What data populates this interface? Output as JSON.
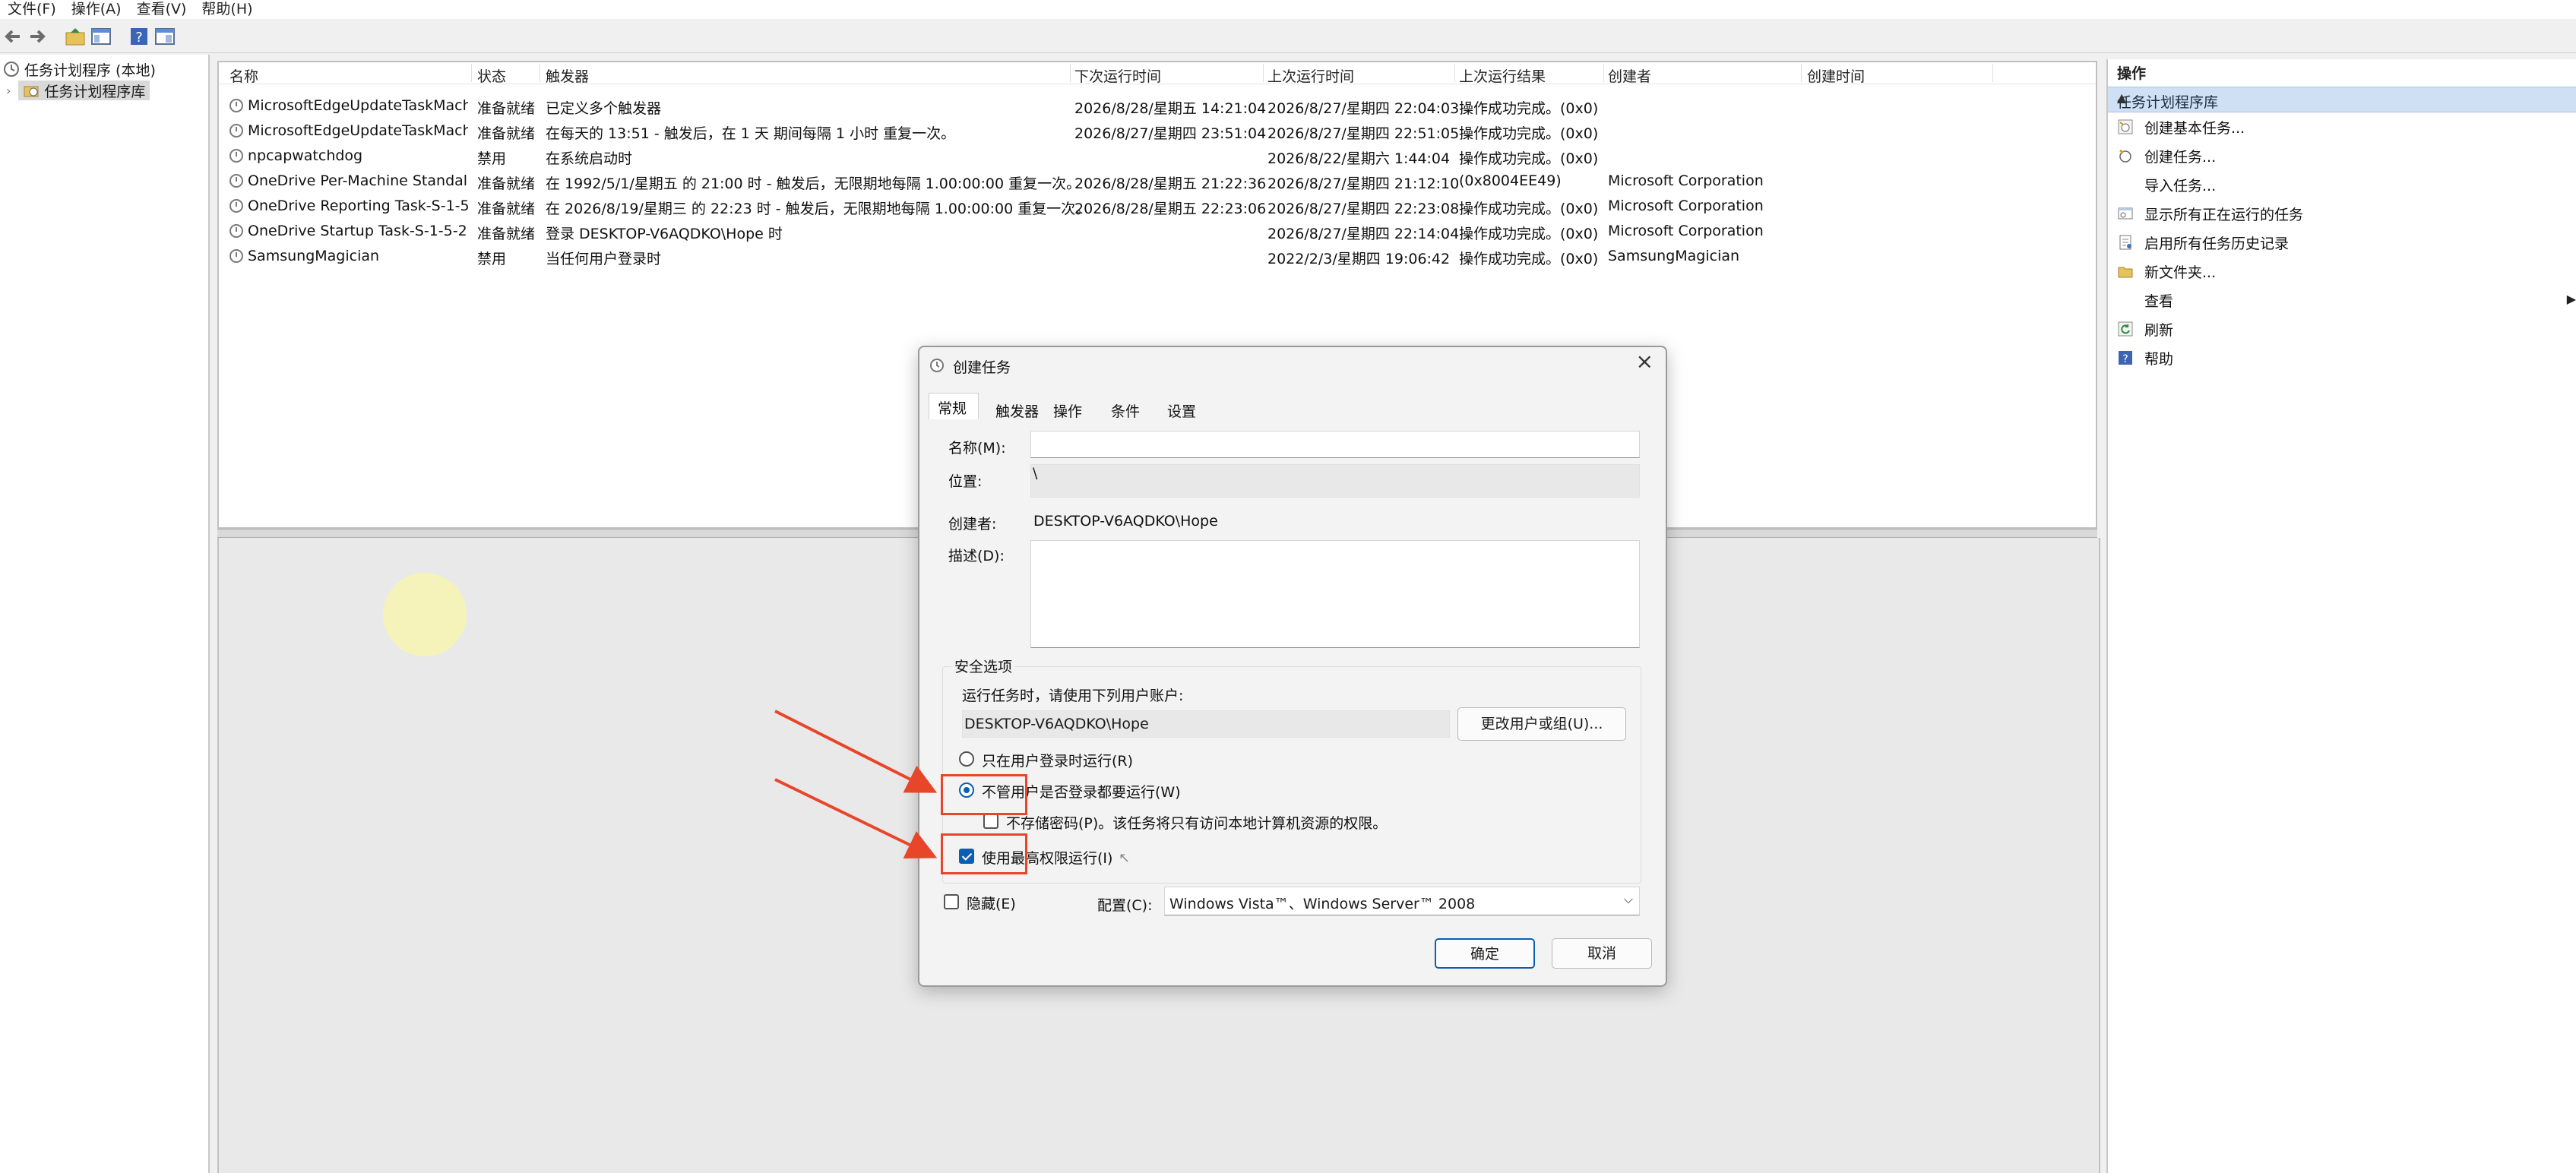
{
  "menu": [
    "文件(F)",
    "操作(A)",
    "查看(V)",
    "帮助(H)"
  ],
  "tree": {
    "root": "任务计划程序 (本地)",
    "library": "任务计划程序库"
  },
  "table": {
    "columns": [
      "名称",
      "状态",
      "触发器",
      "下次运行时间",
      "上次运行时间",
      "上次运行结果",
      "创建者",
      "创建时间"
    ],
    "rows": [
      {
        "name": "MicrosoftEdgeUpdateTaskMachi...",
        "status": "准备就绪",
        "trigger": "已定义多个触发器",
        "next": "2026/8/28/星期五 14:21:04",
        "last": "2026/8/27/星期四 22:04:03",
        "result": "操作成功完成。(0x0)",
        "author": ""
      },
      {
        "name": "MicrosoftEdgeUpdateTaskMachi...",
        "status": "准备就绪",
        "trigger": "在每天的 13:51 - 触发后，在 1 天 期间每隔 1 小时 重复一次。",
        "next": "2026/8/27/星期四 23:51:04",
        "last": "2026/8/27/星期四 22:51:05",
        "result": "操作成功完成。(0x0)",
        "author": ""
      },
      {
        "name": "npcapwatchdog",
        "status": "禁用",
        "trigger": "在系统启动时",
        "next": "",
        "last": "2026/8/22/星期六 1:44:04",
        "result": "操作成功完成。(0x0)",
        "author": ""
      },
      {
        "name": "OneDrive Per-Machine Standalo...",
        "status": "准备就绪",
        "trigger": "在 1992/5/1/星期五 的 21:00 时 - 触发后，无限期地每隔 1.00:00:00 重复一次。",
        "next": "2026/8/28/星期五 21:22:36",
        "last": "2026/8/27/星期四 21:12:10",
        "result": "(0x8004EE49)",
        "author": "Microsoft Corporation"
      },
      {
        "name": "OneDrive Reporting Task-S-1-5...",
        "status": "准备就绪",
        "trigger": "在 2026/8/19/星期三 的 22:23 时 - 触发后，无限期地每隔 1.00:00:00 重复一次。",
        "next": "2026/8/28/星期五 22:23:06",
        "last": "2026/8/27/星期四 22:23:08",
        "result": "操作成功完成。(0x0)",
        "author": "Microsoft Corporation"
      },
      {
        "name": "OneDrive Startup Task-S-1-5-2...",
        "status": "准备就绪",
        "trigger": "登录 DESKTOP-V6AQDKO\\Hope 时",
        "next": "",
        "last": "2026/8/27/星期四 22:14:04",
        "result": "操作成功完成。(0x0)",
        "author": "Microsoft Corporation"
      },
      {
        "name": "SamsungMagician",
        "status": "禁用",
        "trigger": "当任何用户登录时",
        "next": "",
        "last": "2022/2/3/星期四 19:06:42",
        "result": "操作成功完成。(0x0)",
        "author": "SamsungMagician"
      }
    ]
  },
  "actions": {
    "title": "操作",
    "section": "任务计划程序库",
    "items": [
      {
        "label": "创建基本任务...",
        "icon": "wizard-icon"
      },
      {
        "label": "创建任务...",
        "icon": "new-task-icon"
      },
      {
        "label": "导入任务...",
        "icon": ""
      },
      {
        "label": "显示所有正在运行的任务",
        "icon": "running-tasks-icon"
      },
      {
        "label": "启用所有任务历史记录",
        "icon": "history-icon"
      },
      {
        "label": "新文件夹...",
        "icon": "folder-icon"
      },
      {
        "label": "查看",
        "icon": ""
      },
      {
        "label": "刷新",
        "icon": "refresh-icon"
      },
      {
        "label": "帮助",
        "icon": "help-icon"
      }
    ]
  },
  "dialog": {
    "title": "创建任务",
    "tabs": [
      "常规",
      "触发器",
      "操作",
      "条件",
      "设置"
    ],
    "name_label": "名称(M):",
    "name_value": "",
    "location_label": "位置:",
    "location_value": "\\",
    "author_label": "创建者:",
    "author_value": "DESKTOP-V6AQDKO\\Hope",
    "desc_label": "描述(D):",
    "desc_value": "",
    "security_group": "安全选项",
    "run_as_label": "运行任务时，请使用下列用户账户:",
    "run_as_value": "DESKTOP-V6AQDKO\\Hope",
    "change_user_btn": "更改用户或组(U)...",
    "radio_logged_on": "只在用户登录时运行(R)",
    "radio_whether": "不管用户是否登录都要运行(W)",
    "radio_whether_selected": true,
    "no_store_pw": "不存储密码(P)。该任务将只有访问本地计算机资源的权限。",
    "highest_priv": "使用最高权限运行(I)",
    "highest_priv_checked": true,
    "hidden_label": "隐藏(E)",
    "config_label": "配置(C):",
    "config_value": "Windows Vista™、Windows Server™ 2008",
    "ok": "确定",
    "cancel": "取消"
  },
  "colors": {
    "accent": "#0a5fb4",
    "annotation": "#e8462a",
    "actions_section_bg": "#cfe0f4"
  }
}
